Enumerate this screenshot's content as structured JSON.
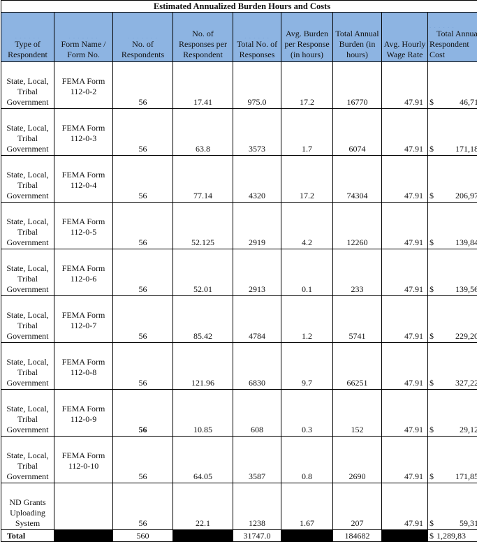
{
  "title": "Estimated Annualized Burden Hours and Costs",
  "headers": {
    "type": "Type of Respondent",
    "form": "Form Name / Form No.",
    "respondents": "No. of Respondents",
    "responses_per": "No. of Responses per Respondent",
    "total_responses": "Total No. of Responses",
    "avg_burden": "Avg. Burden per Response (in hours)",
    "total_burden": "Total Annual Burden (in hours)",
    "wage": "Avg. Hourly Wage Rate",
    "total_cost": "Total Annual Respondent Cost"
  },
  "rows": [
    {
      "type": "State, Local, Tribal Government",
      "form": "FEMA Form 112-0-2",
      "respondents": "56",
      "responses_per": "17.41",
      "total_responses": "975.0",
      "avg_burden": "17.2",
      "total_burden": "16770",
      "wage": "47.91",
      "cost_symbol": "$",
      "cost": "46,71"
    },
    {
      "type": "State, Local, Tribal Government",
      "form": "FEMA Form 112-0-3",
      "respondents": "56",
      "responses_per": "63.8",
      "total_responses": "3573",
      "avg_burden": "1.7",
      "total_burden": "6074",
      "wage": "47.91",
      "cost_symbol": "$",
      "cost": "171,18"
    },
    {
      "type": "State, Local, Tribal Government",
      "form": "FEMA Form 112-0-4",
      "respondents": "56",
      "responses_per": "77.14",
      "total_responses": "4320",
      "avg_burden": "17.2",
      "total_burden": "74304",
      "wage": "47.91",
      "cost_symbol": "$",
      "cost": "206,97"
    },
    {
      "type": "State, Local, Tribal Government",
      "form": "FEMA Form 112-0-5",
      "respondents": "56",
      "responses_per": "52.125",
      "total_responses": "2919",
      "avg_burden": "4.2",
      "total_burden": "12260",
      "wage": "47.91",
      "cost_symbol": "$",
      "cost": "139,84"
    },
    {
      "type": "State, Local, Tribal Government",
      "form": "FEMA Form 112-0-6",
      "respondents": "56",
      "responses_per": "52.01",
      "total_responses": "2913",
      "avg_burden": "0.1",
      "total_burden": "233",
      "wage": "47.91",
      "cost_symbol": "$",
      "cost": "139,56"
    },
    {
      "type": "State, Local, Tribal Government",
      "form": "FEMA Form 112-0-7",
      "respondents": "56",
      "responses_per": "85.42",
      "total_responses": "4784",
      "avg_burden": "1.2",
      "total_burden": "5741",
      "wage": "47.91",
      "cost_symbol": "$",
      "cost": "229,20"
    },
    {
      "type": "State, Local, Tribal Government",
      "form": "FEMA Form 112-0-8",
      "respondents": "56",
      "responses_per": "121.96",
      "total_responses": "6830",
      "avg_burden": "9.7",
      "total_burden": "66251",
      "wage": "47.91",
      "cost_symbol": "$",
      "cost": "327,22"
    },
    {
      "type": "State, Local, Tribal Government",
      "form": "FEMA Form 112-0-9",
      "respondents": "56",
      "respondents_bold": true,
      "responses_per": "10.85",
      "total_responses": "608",
      "avg_burden": "0.3",
      "total_burden": "152",
      "wage": "47.91",
      "cost_symbol": "$",
      "cost": "29,12"
    },
    {
      "type": "State, Local, Tribal Government",
      "form": "FEMA Form 112-0-10",
      "respondents": "56",
      "responses_per": "64.05",
      "total_responses": "3587",
      "avg_burden": "0.8",
      "total_burden": "2690",
      "wage": "47.91",
      "cost_symbol": "$",
      "cost": "171,85"
    },
    {
      "type": "ND Grants Uploading System",
      "form": "",
      "respondents": "56",
      "responses_per": "22.1",
      "total_responses": "1238",
      "avg_burden": "1.67",
      "total_burden": "207",
      "wage": "47.91",
      "cost_symbol": "$",
      "cost": "59,31"
    }
  ],
  "total": {
    "label": "Total",
    "respondents": "560",
    "total_responses": "31747.0",
    "total_burden": "184682",
    "cost_symbol": "$",
    "cost": "1,289,83"
  },
  "colors": {
    "header_bg": "#8db4e2",
    "blackout": "#000000"
  }
}
